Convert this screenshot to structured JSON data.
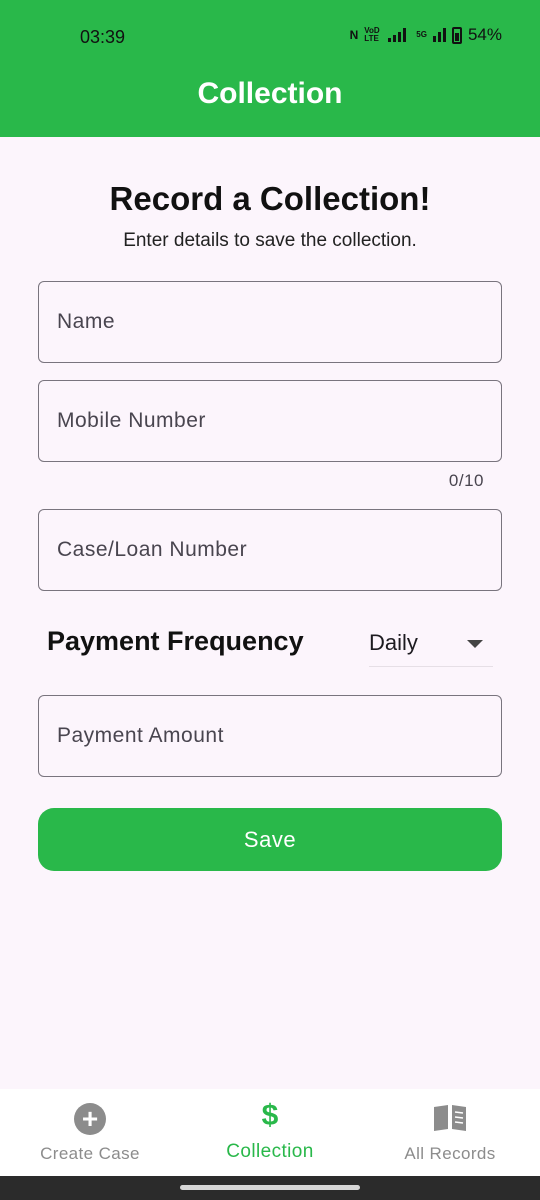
{
  "status_bar": {
    "time": "03:39",
    "battery": "54%",
    "icons": [
      "nfc-icon",
      "volte-icon",
      "signal-icon",
      "5g-signal-icon",
      "battery-icon"
    ],
    "volte_text": "VoD LTE",
    "fiveg_text": "5G"
  },
  "app_bar": {
    "title": "Collection",
    "color": "#29b84a"
  },
  "form": {
    "heading": "Record a Collection!",
    "subheading": "Enter details to save the collection.",
    "name_placeholder": "Name",
    "mobile_placeholder": "Mobile Number",
    "mobile_counter": "0/10",
    "case_placeholder": "Case/Loan Number",
    "frequency_label": "Payment Frequency",
    "frequency_value": "Daily",
    "amount_placeholder": "Payment Amount",
    "save_label": "Save"
  },
  "bottom_nav": {
    "items": [
      {
        "label": "Create Case",
        "icon": "add-circle-icon",
        "active": false
      },
      {
        "label": "Collection",
        "icon": "dollar-icon",
        "active": true
      },
      {
        "label": "All Records",
        "icon": "book-icon",
        "active": false
      }
    ]
  }
}
